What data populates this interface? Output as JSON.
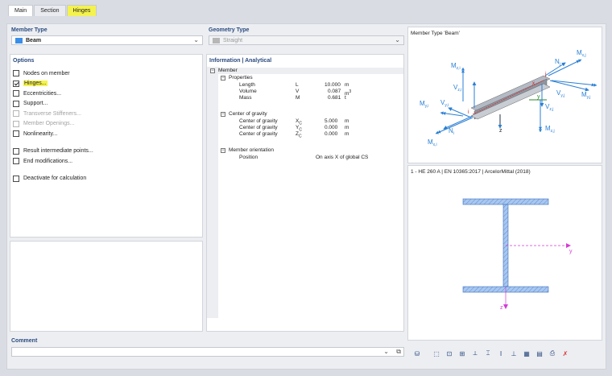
{
  "tabs": [
    {
      "label": "Main"
    },
    {
      "label": "Section"
    },
    {
      "label": "Hinges"
    }
  ],
  "member_type": {
    "header": "Member Type",
    "value": "Beam",
    "color": "#3a8ee8"
  },
  "geometry_type": {
    "header": "Geometry Type",
    "value": "Straight",
    "color": "#b7b7b7"
  },
  "options": {
    "header": "Options",
    "items": [
      {
        "label": "Nodes on member",
        "checked": false,
        "disabled": false
      },
      {
        "label": "Hinges...",
        "checked": true,
        "disabled": false
      },
      {
        "label": "Eccentricities...",
        "checked": false,
        "disabled": false
      },
      {
        "label": "Support...",
        "checked": false,
        "disabled": false
      },
      {
        "label": "Transverse Stiffeners...",
        "checked": false,
        "disabled": true
      },
      {
        "label": "Member Openings...",
        "checked": false,
        "disabled": true
      },
      {
        "label": "Nonlinearity...",
        "checked": false,
        "disabled": false
      },
      {
        "label": "Result intermediate points...",
        "checked": false,
        "disabled": false
      },
      {
        "label": "End modifications...",
        "checked": false,
        "disabled": false
      },
      {
        "label": "Deactivate for calculation",
        "checked": false,
        "disabled": false
      }
    ]
  },
  "info": {
    "header": "Information | Analytical",
    "member": "Member",
    "properties": "Properties",
    "length": {
      "name": "Length",
      "sym": "L",
      "value": "10.000",
      "unit": "m"
    },
    "volume": {
      "name": "Volume",
      "sym": "V",
      "value": "0.087",
      "unit": "m",
      "sup": "3"
    },
    "mass": {
      "name": "Mass",
      "sym": "M",
      "value": "0.681",
      "unit": "t"
    },
    "cog": "Center of gravity",
    "cog_x": {
      "name": "Center of gravity",
      "sym": "X",
      "sub": "C",
      "value": "5.000",
      "unit": "m"
    },
    "cog_y": {
      "name": "Center of gravity",
      "sym": "Y",
      "sub": "C",
      "value": "0.000",
      "unit": "m"
    },
    "cog_z": {
      "name": "Center of gravity",
      "sym": "Z",
      "sub": "C",
      "value": "0.000",
      "unit": "m"
    },
    "orientation": "Member orientation",
    "position": {
      "name": "Position",
      "value": "On axis X of global CS"
    }
  },
  "diagram": {
    "title": "Member Type 'Beam'",
    "labels": {
      "mzi": "M",
      "mzi_sub": "z,i",
      "vzi": "V",
      "vzi_sub": "z,i",
      "myi": "M",
      "myi_sub": "y,i",
      "vyi": "V",
      "vyi_sub": "y,i",
      "ni": "N",
      "ni_sub": "i",
      "mxi": "M",
      "mxi_sub": "x,i",
      "nj": "N",
      "nj_sub": "j",
      "mxj": "M",
      "mxj_sub": "x,j",
      "vyj": "V",
      "vyj_sub": "y,j",
      "myj": "M",
      "myj_sub": "y,j",
      "vzj": "V",
      "vzj_sub": "z,j",
      "mzj": "M",
      "mzj_sub": "z,j",
      "y": "y",
      "z": "z",
      "i": "i",
      "j": "j",
      "x": "x"
    }
  },
  "section": {
    "title": "1 - HE 260 A | EN 10365:2017 | ArcelorMittal (2018)",
    "axis_y": "y",
    "axis_z": "z"
  },
  "comment": {
    "header": "Comment",
    "value": ""
  },
  "colors": {
    "accent": "#2b4b7f",
    "highlight": "#f4f24e",
    "arrow": "#2a7fd4",
    "section_fill": "#a9c7ef",
    "axis_y": "#d43bd4"
  }
}
